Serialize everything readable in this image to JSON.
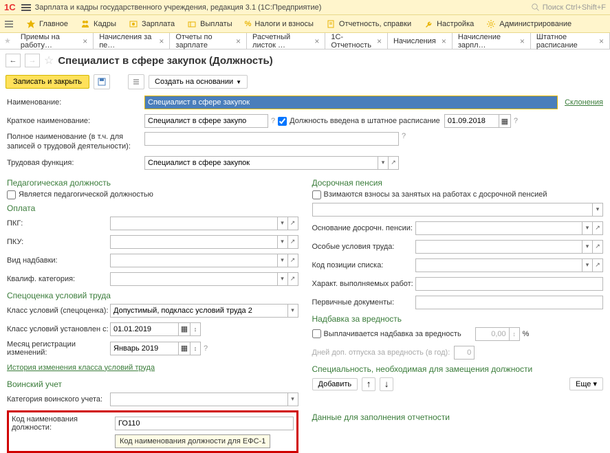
{
  "topbar": {
    "app_title": "Зарплата и кадры государственного учреждения, редакция 3.1 (1С:Предприятие)",
    "search_placeholder": "Поиск Ctrl+Shift+F"
  },
  "nav": {
    "main": "Главное",
    "kadry": "Кадры",
    "zarplata": "Зарплата",
    "vyplaty": "Выплаты",
    "nalogi": "Налоги и взносы",
    "otchet": "Отчетность, справки",
    "nastroika": "Настройка",
    "admin": "Администрирование"
  },
  "tabs": [
    "Приемы на работу…",
    "Начисления за пе…",
    "Отчеты по зарплате",
    "Расчетный листок …",
    "1С-Отчетность",
    "Начисления",
    "Начисление зарпл…",
    "Штатное расписание"
  ],
  "page_title": "Специалист в сфере закупок (Должность)",
  "toolbar": {
    "save_close": "Записать и закрыть",
    "create_based": "Создать на основании"
  },
  "form": {
    "name_label": "Наименование:",
    "name_value": "Специалист в сфере закупок",
    "declension": "Склонения",
    "short_label": "Краткое наименование:",
    "short_value": "Специалист в сфере закупо",
    "in_schedule": "Должность введена в штатное расписание",
    "schedule_date": "01.09.2018",
    "full_label": "Полное наименование (в т.ч. для записей о трудовой деятельности):",
    "func_label": "Трудовая функция:",
    "func_value": "Специалист в сфере закупок"
  },
  "pedag": {
    "title": "Педагогическая должность",
    "is_pedag": "Является педагогической должностью"
  },
  "oplata": {
    "title": "Оплата",
    "pkg": "ПКГ:",
    "pku": "ПКУ:",
    "nadbavka": "Вид надбавки:",
    "kvalif": "Квалиф. категория:"
  },
  "spec": {
    "title": "Спецоценка условий труда",
    "class_label": "Класс условий (спецоценка):",
    "class_value": "Допустимый, подкласс условий труда 2",
    "date_label": "Класс условий установлен с:",
    "date_value": "01.01.2019",
    "month_label": "Месяц регистрации изменений:",
    "month_value": "Январь 2019",
    "history": "История изменения класса условий труда"
  },
  "voin": {
    "title": "Воинский учет",
    "cat_label": "Категория воинского учета:",
    "code_label": "Код наименования должности:",
    "code_value": "ГО110",
    "tooltip": "Код наименования должности для ЕФС-1"
  },
  "pension": {
    "title": "Досрочная пенсия",
    "vzimat": "Взимаются взносы за занятых на работах с досрочной пенсией",
    "osnovanie": "Основание досрочн. пенсии:",
    "osobye": "Особые условия труда:",
    "kod_poz": "Код позиции списка:",
    "kharakt": "Характ. выполняемых работ:",
    "pervich": "Первичные документы:"
  },
  "vrednost": {
    "title": "Надбавка за вредность",
    "vypl": "Выплачивается надбавка за вредность",
    "value": "0,00",
    "percent": "%",
    "days_label": "Дней доп. отпуска за вредность (в год):",
    "days_value": "0"
  },
  "specialty": {
    "title": "Специальность, необходимая для замещения должности",
    "add": "Добавить",
    "more": "Еще"
  },
  "report": {
    "title": "Данные для заполнения отчетности"
  }
}
